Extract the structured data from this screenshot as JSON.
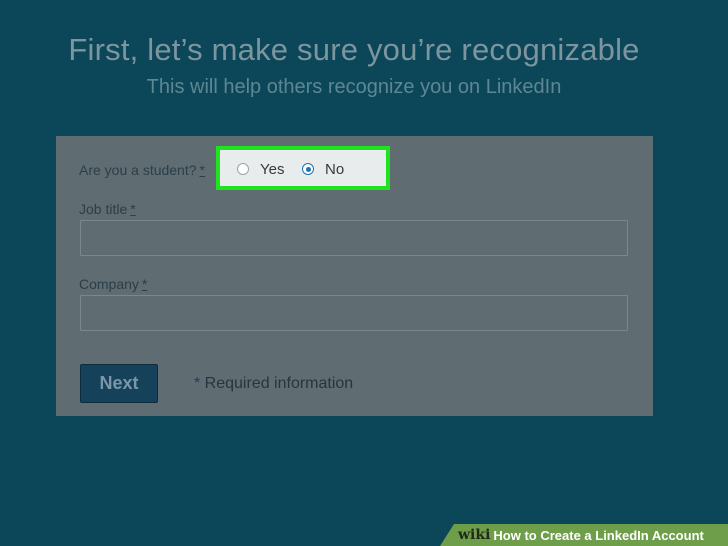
{
  "header": {
    "title": "First, let’s make sure you’re recognizable",
    "subtitle": "This will help others recognize you on LinkedIn"
  },
  "form": {
    "student_question": "Are you a student?",
    "required_marker": "*",
    "student_options": [
      {
        "label": "Yes",
        "checked": false
      },
      {
        "label": "No",
        "checked": true
      }
    ],
    "job_title_label": "Job title",
    "job_title_value": "",
    "company_label": "Company",
    "company_value": "",
    "next_label": "Next",
    "required_star": "*",
    "required_text": " Required information"
  },
  "watermark": {
    "brand": "wiki",
    "how": "How",
    "rest": " to Create a LinkedIn Account"
  },
  "colors": {
    "background": "#0c4659",
    "highlight_border": "#1ee31e",
    "button": "#16415b",
    "banner": "#6f9e4a"
  }
}
